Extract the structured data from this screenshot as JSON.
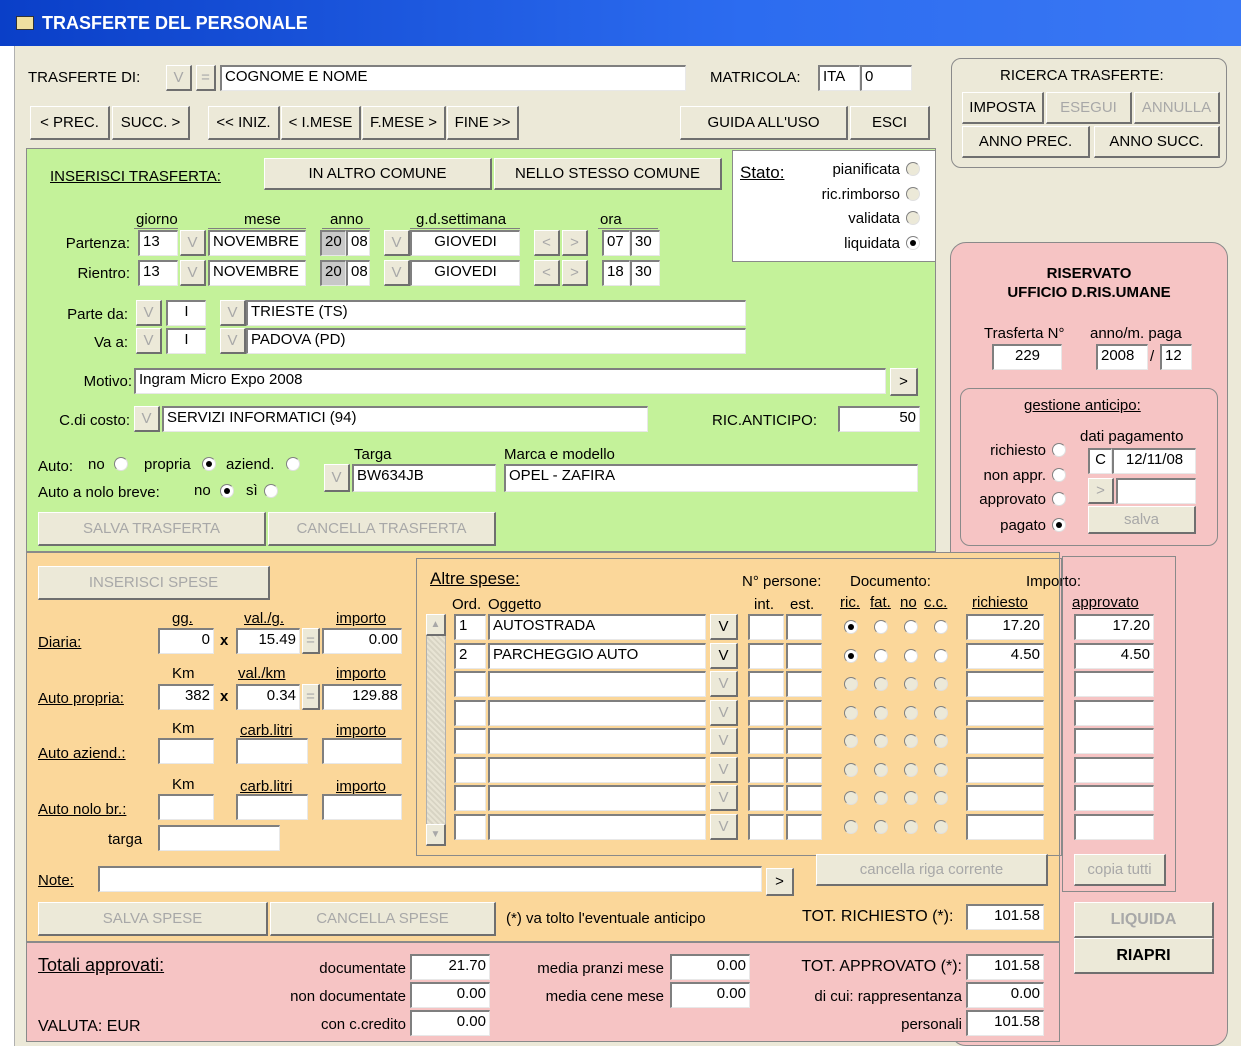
{
  "window": {
    "title": "TRASFERTE DEL PERSONALE"
  },
  "top": {
    "trasferte_di": "TRASFERTE DI:",
    "v": "V",
    "eq": "=",
    "nome": "COGNOME E NOME",
    "matricola_lbl": "MATRICOLA:",
    "matricola_prefix": "ITA",
    "matricola_num": "0"
  },
  "nav": {
    "prec": "< PREC.",
    "succ": "SUCC. >",
    "iniz": "<< INIZ.",
    "imese": "< I.MESE",
    "fmese": "F.MESE >",
    "fine": "FINE >>",
    "guida": "GUIDA ALL'USO",
    "esci": "ESCI"
  },
  "ricerca": {
    "title": "RICERCA TRASFERTE:",
    "imposta": "IMPOSTA",
    "esegui": "ESEGUI",
    "annulla": "ANNULLA",
    "anno_prec": "ANNO PREC.",
    "anno_succ": "ANNO SUCC."
  },
  "ins": {
    "title": "INSERISCI TRASFERTA:",
    "altro": "IN ALTRO COMUNE",
    "stesso": "NELLO STESSO COMUNE"
  },
  "stato": {
    "title": "Stato:",
    "options": [
      "pianificata",
      "ric.rimborso",
      "validata",
      "liquidata"
    ],
    "selected": "liquidata"
  },
  "dates": {
    "h_giorno": "giorno",
    "h_mese": "mese",
    "h_anno": "anno",
    "h_gds": "g.d.settimana",
    "h_ora": "ora",
    "partenza_lbl": "Partenza:",
    "rientro_lbl": "Rientro:",
    "partenza": {
      "giorno": "13",
      "mese": "NOVEMBRE",
      "anno_a": "20",
      "anno_b": "08",
      "gds": "GIOVEDI",
      "ora_h": "07",
      "ora_m": "30"
    },
    "rientro": {
      "giorno": "13",
      "mese": "NOVEMBRE",
      "anno_a": "20",
      "anno_b": "08",
      "gds": "GIOVEDI",
      "ora_h": "18",
      "ora_m": "30"
    }
  },
  "route": {
    "parte_lbl": "Parte da:",
    "va_lbl": "Va a:",
    "parte_country": "I",
    "parte_city": "TRIESTE (TS)",
    "va_country": "I",
    "va_city": "PADOVA (PD)"
  },
  "motivo": {
    "lbl": "Motivo:",
    "value": "Ingram Micro Expo 2008",
    "arrow": ">"
  },
  "costo": {
    "lbl": "C.di costo:",
    "value": "SERVIZI INFORMATICI (94)",
    "anticipo_lbl": "RIC.ANTICIPO:",
    "anticipo": "50"
  },
  "auto": {
    "lbl": "Auto:",
    "no": "no",
    "propria": "propria",
    "aziend": "aziend.",
    "selected": "propria",
    "nolo_lbl": "Auto a nolo breve:",
    "nolo_no": "no",
    "nolo_si": "sì",
    "nolo_selected": "no",
    "targa_lbl": "Targa",
    "targa": "BW634JB",
    "marca_lbl": "Marca e modello",
    "marca": "OPEL - ZAFIRA"
  },
  "save1": {
    "salva": "SALVA TRASFERTA",
    "cancella": "CANCELLA TRASFERTA"
  },
  "riservato": {
    "title1": "RISERVATO",
    "title2": "UFFICIO D.RIS.UMANE",
    "trasf_lbl": "Trasferta N°",
    "trasf": "229",
    "anno_lbl": "anno/m. paga",
    "anno": "2008",
    "mese": "12"
  },
  "anticipo": {
    "title": "gestione anticipo:",
    "options": [
      "richiesto",
      "non appr.",
      "approvato",
      "pagato"
    ],
    "selected": "pagato",
    "dati_lbl": "dati pagamento",
    "tipo": "C",
    "data": "12/11/08",
    "arrow": ">",
    "salva": "salva"
  },
  "spese": {
    "inserisci": "INSERISCI SPESE",
    "diaria": {
      "lbl": "Diaria:",
      "h1": "gg.",
      "h2": "val./g.",
      "h3": "importo",
      "v1": "0",
      "x": "x",
      "v2": "15.49",
      "eq": "=",
      "v3": "0.00"
    },
    "propria": {
      "lbl": "Auto propria:",
      "h1": "Km",
      "h2": "val./km",
      "h3": "importo",
      "v1": "382",
      "x": "x",
      "v2": "0.34",
      "eq": "=",
      "v3": "129.88"
    },
    "aziend": {
      "lbl": "Auto aziend.:",
      "h1": "Km",
      "h2": "carb.litri",
      "h3": "importo"
    },
    "nolo": {
      "lbl": "Auto nolo br.:",
      "h1": "Km",
      "h2": "carb.litri",
      "h3": "importo"
    },
    "targa_lbl": "targa",
    "note_lbl": "Note:",
    "note_arrow": ">",
    "salva": "SALVA SPESE",
    "cancella": "CANCELLA SPESE",
    "nota": "(*) va tolto l'eventuale anticipo",
    "tot_rich_lbl": "TOT. RICHIESTO (*):",
    "tot_rich": "101.58"
  },
  "altre": {
    "title": "Altre spese:",
    "h_ord": "Ord.",
    "h_ogg": "Oggetto",
    "h_npers": "N° persone:",
    "h_int": "int.",
    "h_est": "est.",
    "h_doc": "Documento:",
    "h_ric": "ric.",
    "h_fat": "fat.",
    "h_no": "no",
    "h_cc": "c.c.",
    "h_imp": "Importo:",
    "h_rich": "richiesto",
    "h_appr": "approvato",
    "rows": [
      {
        "ord": "1",
        "ogg": "AUTOSTRADA",
        "v": "V",
        "rich": "17.20",
        "appr": "17.20"
      },
      {
        "ord": "2",
        "ogg": "PARCHEGGIO AUTO",
        "v": "V",
        "rich": "4.50",
        "appr": "4.50"
      },
      {
        "ord": "",
        "ogg": "",
        "v": "V",
        "rich": "",
        "appr": ""
      },
      {
        "ord": "",
        "ogg": "",
        "v": "V",
        "rich": "",
        "appr": ""
      },
      {
        "ord": "",
        "ogg": "",
        "v": "V",
        "rich": "",
        "appr": ""
      },
      {
        "ord": "",
        "ogg": "",
        "v": "V",
        "rich": "",
        "appr": ""
      },
      {
        "ord": "",
        "ogg": "",
        "v": "V",
        "rich": "",
        "appr": ""
      },
      {
        "ord": "",
        "ogg": "",
        "v": "V",
        "rich": "",
        "appr": ""
      }
    ],
    "cancella_riga": "cancella riga corrente",
    "copia": "copia tutti"
  },
  "liq": {
    "liquida": "LIQUIDA",
    "riapri": "RIAPRI"
  },
  "totali": {
    "title": "Totali approvati:",
    "valuta": "VALUTA: EUR",
    "doc_lbl": "documentate",
    "doc": "21.70",
    "nondoc_lbl": "non documentate",
    "nondoc": "0.00",
    "cc_lbl": "con c.credito",
    "cc": "0.00",
    "pranzi_lbl": "media pranzi mese",
    "pranzi": "0.00",
    "cene_lbl": "media cene mese",
    "cene": "0.00",
    "tot_appr_lbl": "TOT. APPROVATO (*):",
    "tot_appr": "101.58",
    "rappr_lbl": "di cui: rappresentanza",
    "rappr": "0.00",
    "pers_lbl": "personali",
    "pers": "101.58"
  }
}
